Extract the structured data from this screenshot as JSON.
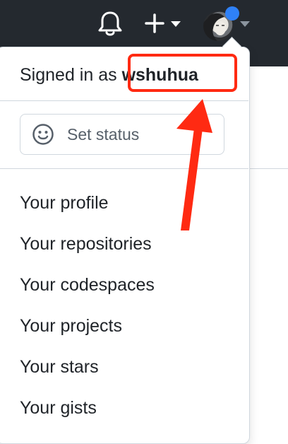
{
  "header": {
    "icons": [
      "bell-icon",
      "plus-icon",
      "caret-down-icon",
      "avatar",
      "status-dot",
      "caret-down-icon"
    ]
  },
  "dropdown": {
    "signed_in_prefix": "Signed in as",
    "username": "wshuhua",
    "set_status_label": "Set status",
    "items": [
      {
        "label": "Your profile"
      },
      {
        "label": "Your repositories"
      },
      {
        "label": "Your codespaces"
      },
      {
        "label": "Your projects"
      },
      {
        "label": "Your stars"
      },
      {
        "label": "Your gists"
      }
    ]
  },
  "colors": {
    "topbar": "#24292f",
    "annotation": "#ff2a12",
    "notification_dot": "#2f81f7",
    "border": "#d0d7de"
  },
  "annotation": {
    "type": "highlight-box-with-arrow",
    "target": "username"
  }
}
